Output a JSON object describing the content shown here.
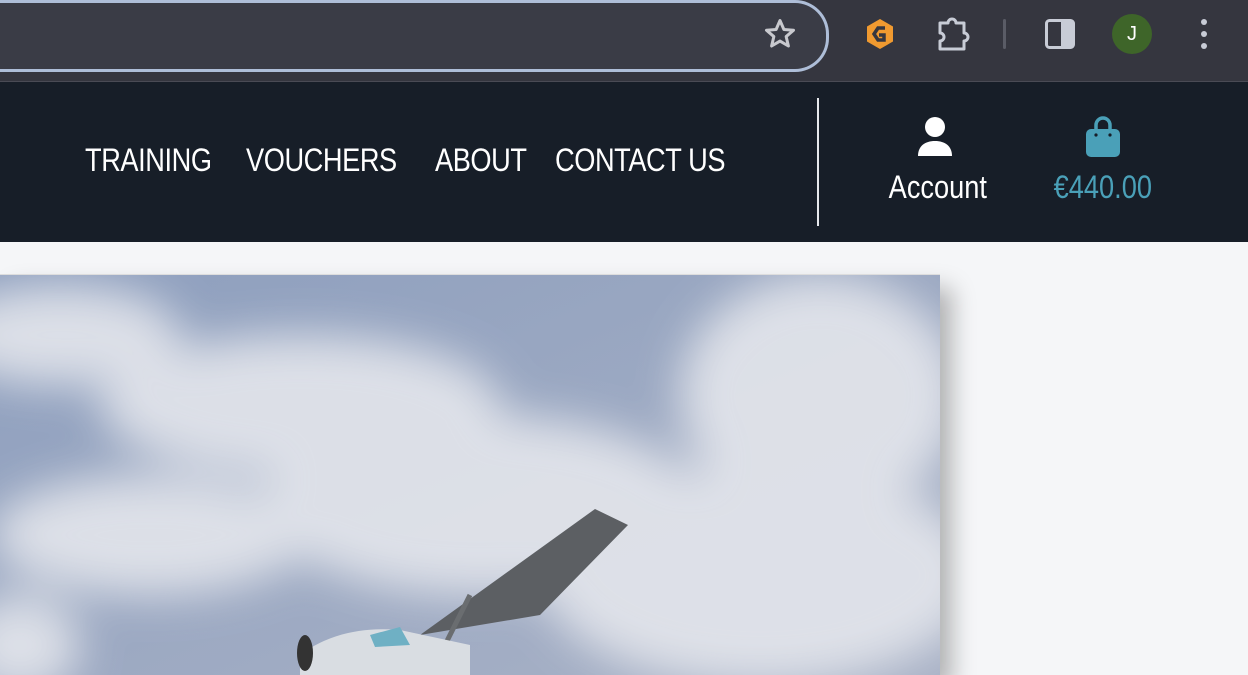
{
  "browser": {
    "avatar_letter": "J",
    "icons": [
      "star-icon",
      "extension-g-icon",
      "puzzle-icon",
      "side-panel-icon",
      "kebab-menu-icon"
    ],
    "colors": {
      "toolbar": "#35363f",
      "omnibox_border": "#aebed8",
      "avatar": "#3e6529",
      "ext": "#f09a30"
    }
  },
  "nav": {
    "links": [
      "TRAINING",
      "VOUCHERS",
      "ABOUT",
      "CONTACT US"
    ],
    "account_label": "Account",
    "cart_total": "€440.00",
    "colors": {
      "background": "#171e28",
      "accent": "#4aa0b8"
    }
  },
  "hero": {
    "image": "small-plane-in-cloudy-sky"
  }
}
